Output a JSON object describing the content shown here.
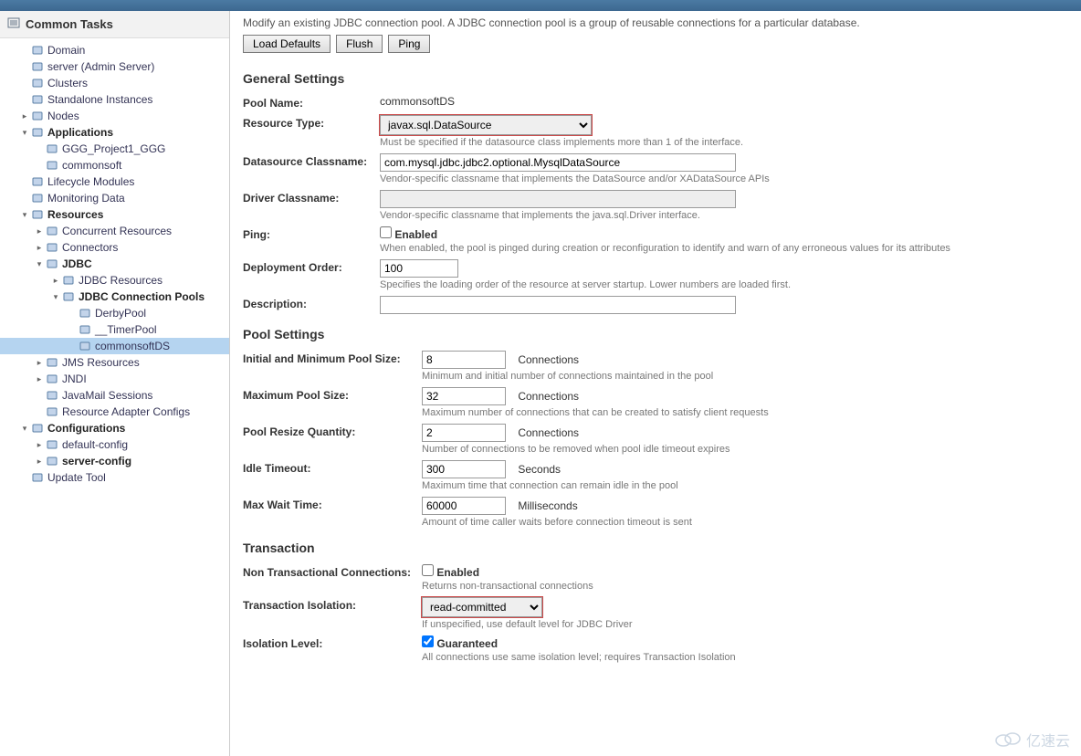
{
  "sidebar": {
    "header": "Common Tasks",
    "items": [
      {
        "label": "Domain",
        "level": 1
      },
      {
        "label": "server (Admin Server)",
        "level": 1
      },
      {
        "label": "Clusters",
        "level": 1
      },
      {
        "label": "Standalone Instances",
        "level": 1
      },
      {
        "label": "Nodes",
        "level": 1,
        "tw": "▸"
      },
      {
        "label": "Applications",
        "level": 1,
        "tw": "▾",
        "bold": true
      },
      {
        "label": "GGG_Project1_GGG",
        "level": 2
      },
      {
        "label": "commonsoft",
        "level": 2
      },
      {
        "label": "Lifecycle Modules",
        "level": 1
      },
      {
        "label": "Monitoring Data",
        "level": 1
      },
      {
        "label": "Resources",
        "level": 1,
        "tw": "▾",
        "bold": true
      },
      {
        "label": "Concurrent Resources",
        "level": 2,
        "tw": "▸"
      },
      {
        "label": "Connectors",
        "level": 2,
        "tw": "▸"
      },
      {
        "label": "JDBC",
        "level": 2,
        "tw": "▾",
        "bold": true
      },
      {
        "label": "JDBC Resources",
        "level": 3,
        "tw": "▸"
      },
      {
        "label": "JDBC Connection Pools",
        "level": 3,
        "tw": "▾",
        "bold": true
      },
      {
        "label": "DerbyPool",
        "level": 4
      },
      {
        "label": "__TimerPool",
        "level": 4
      },
      {
        "label": "commonsoftDS",
        "level": 4,
        "sel": true
      },
      {
        "label": "JMS Resources",
        "level": 2,
        "tw": "▸"
      },
      {
        "label": "JNDI",
        "level": 2,
        "tw": "▸"
      },
      {
        "label": "JavaMail Sessions",
        "level": 2
      },
      {
        "label": "Resource Adapter Configs",
        "level": 2
      },
      {
        "label": "Configurations",
        "level": 1,
        "tw": "▾",
        "bold": true
      },
      {
        "label": "default-config",
        "level": 2,
        "tw": "▸"
      },
      {
        "label": "server-config",
        "level": 2,
        "tw": "▸",
        "bold": true
      },
      {
        "label": "Update Tool",
        "level": 1
      }
    ]
  },
  "page": {
    "desc": "Modify an existing JDBC connection pool. A JDBC connection pool is a group of reusable connections for a particular database.",
    "btn_defaults": "Load Defaults",
    "btn_flush": "Flush",
    "btn_ping": "Ping"
  },
  "general": {
    "heading": "General Settings",
    "pool_name_label": "Pool Name:",
    "pool_name": "commonsoftDS",
    "resource_type_label": "Resource Type:",
    "resource_type": "javax.sql.DataSource",
    "resource_type_help": "Must be specified if the datasource class implements more than 1 of the interface.",
    "ds_class_label": "Datasource Classname:",
    "ds_class": "com.mysql.jdbc.jdbc2.optional.MysqlDataSource",
    "ds_class_help": "Vendor-specific classname that implements the DataSource and/or XADataSource APIs",
    "driver_class_label": "Driver Classname:",
    "driver_class": "",
    "driver_class_help": "Vendor-specific classname that implements the java.sql.Driver interface.",
    "ping_label": "Ping:",
    "ping_cb_label": "Enabled",
    "ping_help": "When enabled, the pool is pinged during creation or reconfiguration to identify and warn of any erroneous values for its attributes",
    "deploy_order_label": "Deployment Order:",
    "deploy_order": "100",
    "deploy_order_help": "Specifies the loading order of the resource at server startup. Lower numbers are loaded first.",
    "description_label": "Description:",
    "description": ""
  },
  "pool": {
    "heading": "Pool Settings",
    "init_label": "Initial and Minimum Pool Size:",
    "init": "8",
    "init_unit": "Connections",
    "init_help": "Minimum and initial number of connections maintained in the pool",
    "max_label": "Maximum Pool Size:",
    "max": "32",
    "max_unit": "Connections",
    "max_help": "Maximum number of connections that can be created to satisfy client requests",
    "resize_label": "Pool Resize Quantity:",
    "resize": "2",
    "resize_unit": "Connections",
    "resize_help": "Number of connections to be removed when pool idle timeout expires",
    "idle_label": "Idle Timeout:",
    "idle": "300",
    "idle_unit": "Seconds",
    "idle_help": "Maximum time that connection can remain idle in the pool",
    "wait_label": "Max Wait Time:",
    "wait": "60000",
    "wait_unit": "Milliseconds",
    "wait_help": "Amount of time caller waits before connection timeout is sent"
  },
  "tx": {
    "heading": "Transaction",
    "non_tx_label": "Non Transactional Connections:",
    "non_tx_cb_label": "Enabled",
    "non_tx_help": "Returns non-transactional connections",
    "iso_label": "Transaction Isolation:",
    "iso": "read-committed",
    "iso_help": "If unspecified, use default level for JDBC Driver",
    "level_label": "Isolation Level:",
    "level_cb_label": "Guaranteed",
    "level_help": "All connections use same isolation level; requires Transaction Isolation"
  },
  "watermark": "亿速云"
}
